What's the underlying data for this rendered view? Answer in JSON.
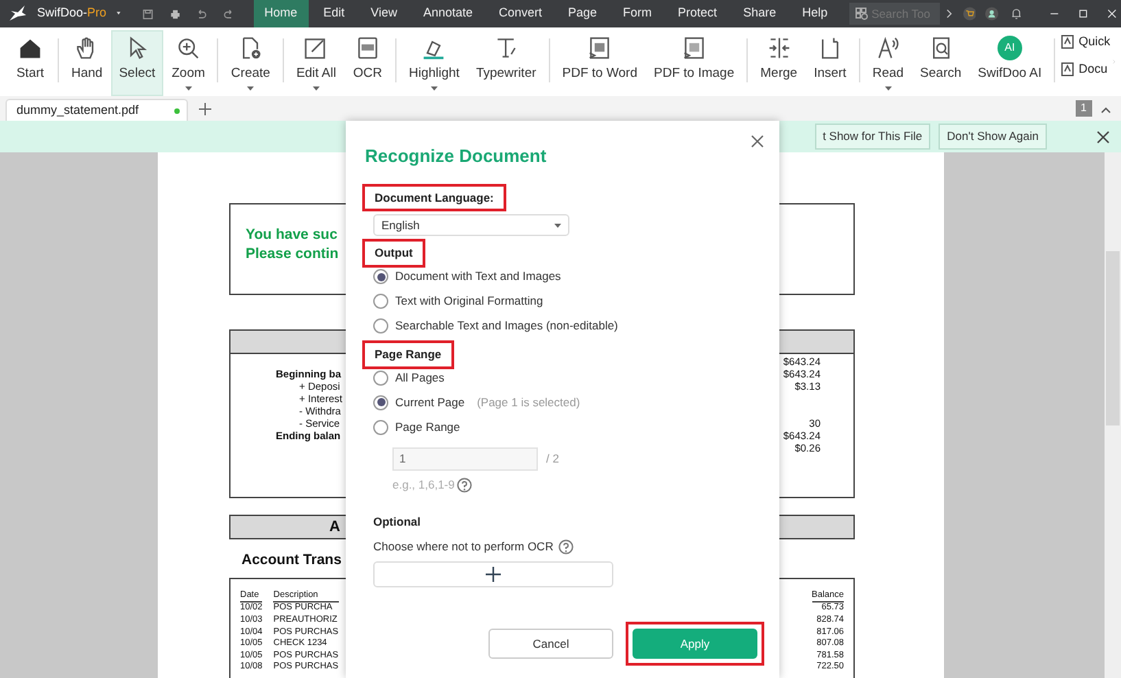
{
  "title_bar": {
    "app_name": "SwifDoo-",
    "edition": "Pro",
    "menu": [
      {
        "label": "Home",
        "selected": true
      },
      {
        "label": "Edit",
        "selected": false
      },
      {
        "label": "View",
        "selected": false
      },
      {
        "label": "Annotate",
        "selected": false
      },
      {
        "label": "Convert",
        "selected": false
      },
      {
        "label": "Page",
        "selected": false
      },
      {
        "label": "Form",
        "selected": false
      },
      {
        "label": "Protect",
        "selected": false
      },
      {
        "label": "Share",
        "selected": false
      },
      {
        "label": "Help",
        "selected": false
      }
    ],
    "search": {
      "placeholder": "Search Too"
    }
  },
  "ribbon": {
    "groups": [
      [
        {
          "label": "Start",
          "has_menu": false,
          "selected": false
        }
      ],
      [
        {
          "label": "Hand",
          "has_menu": false,
          "selected": false
        },
        {
          "label": "Select",
          "has_menu": false,
          "selected": true
        },
        {
          "label": "Zoom",
          "has_menu": true,
          "selected": false
        }
      ],
      [
        {
          "label": "Create",
          "has_menu": true,
          "selected": false
        }
      ],
      [
        {
          "label": "Edit All",
          "has_menu": true,
          "selected": false
        },
        {
          "label": "OCR",
          "has_menu": false,
          "selected": false
        }
      ],
      [
        {
          "label": "Highlight",
          "has_menu": true,
          "selected": false
        },
        {
          "label": "Typewriter",
          "has_menu": false,
          "selected": false
        }
      ],
      [
        {
          "label": "PDF to Word",
          "has_menu": false,
          "selected": false
        },
        {
          "label": "PDF to Image",
          "has_menu": false,
          "selected": false
        }
      ],
      [
        {
          "label": "Merge",
          "has_menu": false,
          "selected": false
        },
        {
          "label": "Insert",
          "has_menu": false,
          "selected": false
        }
      ],
      [
        {
          "label": "Read",
          "has_menu": true,
          "selected": false
        },
        {
          "label": "Search",
          "has_menu": false,
          "selected": false
        },
        {
          "label": "SwifDoo AI",
          "has_menu": false,
          "selected": false,
          "kind": "badge",
          "badge": "AI"
        }
      ]
    ],
    "side_items": [
      "Quick",
      "Docu"
    ]
  },
  "tabs": [
    {
      "label": "dummy_statement.pdf",
      "selected": true,
      "unsaved": true
    }
  ],
  "page_number": "1",
  "notification": {
    "buttons": [
      "t Show for This File",
      "Don't Show Again"
    ]
  },
  "document": {
    "notice_lines": [
      "You have suc",
      "Please contin"
    ],
    "summary_rows": [
      {
        "value": "$643.24"
      },
      {
        "label": "Beginning ba",
        "kind": "total",
        "value": "$643.24"
      },
      {
        "label": "+ Deposi",
        "kind": "item",
        "value": "$3.13"
      },
      {
        "label": "+ Interest",
        "kind": "item"
      },
      {
        "label": "- Withdra",
        "kind": "item"
      },
      {
        "label": "- Service",
        "kind": "item",
        "value": "30"
      },
      {
        "label": "Ending balan",
        "kind": "total",
        "value": "$643.24"
      },
      {
        "value": "$0.26"
      }
    ],
    "section_heading": "A",
    "transactions_title": "Account Trans",
    "table": {
      "columns": [
        "Date",
        "Description",
        "Balance"
      ],
      "rows": [
        {
          "date": "10/02",
          "description": "POS PURCHA",
          "balance": "65.73"
        },
        {
          "date": "10/03",
          "description": "PREAUTHORIZ",
          "balance": "828.74"
        },
        {
          "date": "10/04",
          "description": "POS PURCHAS",
          "balance": "817.06"
        },
        {
          "date": "10/05",
          "description": "CHECK 1234",
          "balance": "807.08"
        },
        {
          "date": "10/05",
          "description": "POS PURCHAS",
          "balance": "781.58"
        },
        {
          "date": "10/08",
          "description": "POS PURCHAS",
          "balance": "722.50"
        }
      ]
    }
  },
  "dialog": {
    "title": "Recognize Document",
    "language": {
      "label": "Document Language:",
      "highlighted": true,
      "value": "English"
    },
    "output": {
      "label": "Output",
      "highlighted": true,
      "options": [
        {
          "label": "Document with Text and Images",
          "selected": true
        },
        {
          "label": "Text with Original Formatting",
          "selected": false
        },
        {
          "label": "Searchable Text and Images (non-editable)",
          "selected": false
        }
      ]
    },
    "page_range": {
      "label": "Page Range",
      "highlighted": true,
      "options": [
        {
          "label": "All Pages",
          "selected": false
        },
        {
          "label": "Current Page",
          "selected": true,
          "hint": "(Page 1 is selected)"
        },
        {
          "label": "Page Range",
          "selected": false
        }
      ],
      "input": {
        "value": "1",
        "disabled": true,
        "total": "/ 2"
      },
      "example": "e.g., 1,6,1-9"
    },
    "optional": {
      "label": "Optional",
      "description": "Choose where not to perform OCR"
    },
    "buttons": [
      {
        "label": "Cancel",
        "kind": "secondary",
        "highlighted": false
      },
      {
        "label": "Apply",
        "kind": "primary",
        "highlighted": true
      }
    ]
  }
}
